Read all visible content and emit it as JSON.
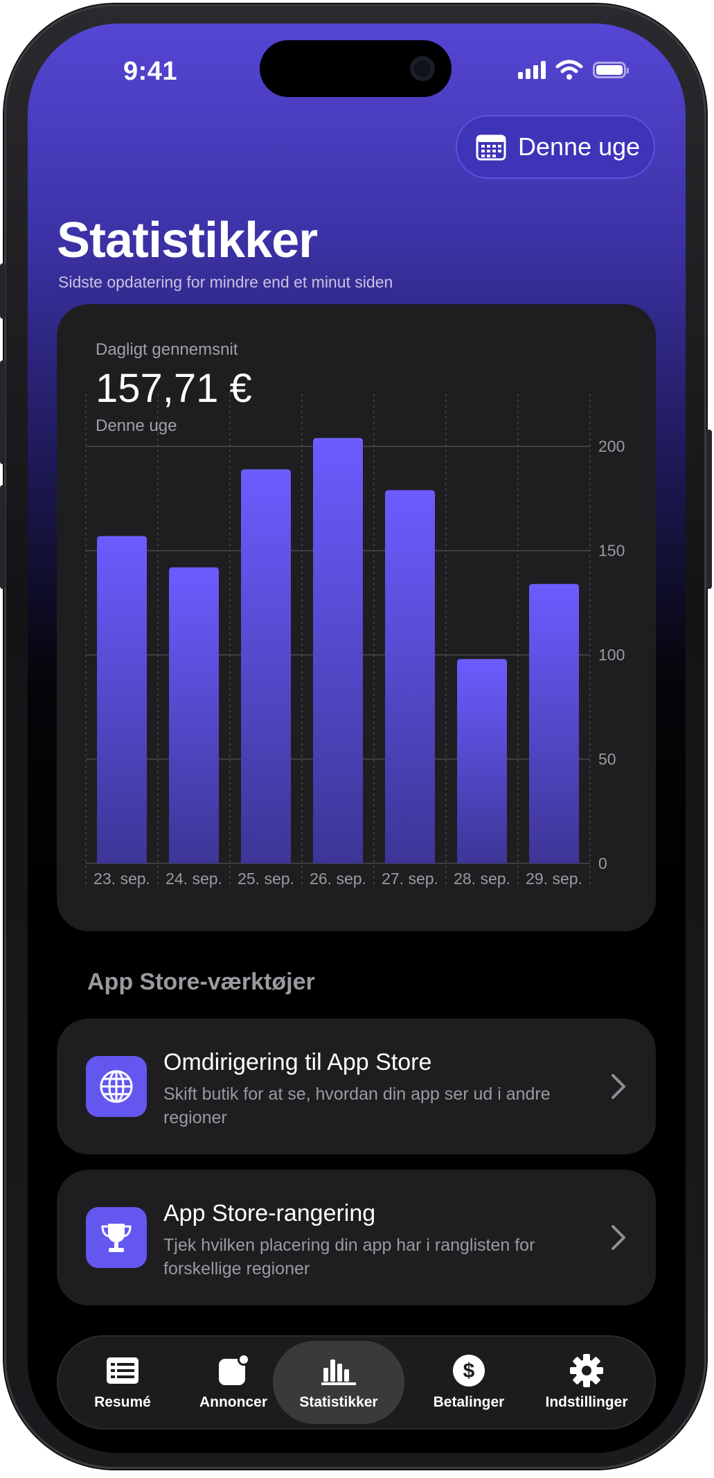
{
  "status_bar": {
    "time": "9:41"
  },
  "header": {
    "period_button": "Denne uge",
    "title": "Statistikker",
    "subtitle": "Sidste opdatering for mindre end et minut siden"
  },
  "summary": {
    "label": "Dagligt gennemsnit",
    "value": "157,71 €",
    "period": "Denne uge"
  },
  "chart_data": {
    "type": "bar",
    "categories": [
      "23. sep.",
      "24. sep.",
      "25. sep.",
      "26. sep.",
      "27. sep.",
      "28. sep.",
      "29. sep."
    ],
    "values": [
      157,
      142,
      189,
      204,
      179,
      98,
      134
    ],
    "ylim": [
      0,
      225
    ],
    "yticks": [
      0,
      50,
      100,
      150,
      200
    ],
    "ytick_labels": [
      "0",
      "50",
      "100",
      "150",
      "200"
    ],
    "y_axis_position": "right",
    "grid": true,
    "colors": {
      "bar_top": "#6c5cff",
      "bar_bottom": "#3d3596"
    }
  },
  "tools": {
    "section_title": "App Store-værktøjer",
    "items": [
      {
        "icon": "globe-icon",
        "title": "Omdirigering til App Store",
        "description": "Skift butik for at se, hvordan din app ser ud i andre regioner"
      },
      {
        "icon": "trophy-icon",
        "title": "App Store-rangering",
        "description": "Tjek hvilken placering din app har i ranglisten for forskellige regioner"
      }
    ]
  },
  "tab_bar": {
    "active": "Statistikker",
    "items": [
      {
        "label": "Resumé",
        "icon": "document-list-icon"
      },
      {
        "label": "Annoncer",
        "icon": "notification-badge-icon"
      },
      {
        "label": "Statistikker",
        "icon": "bar-chart-icon"
      },
      {
        "label": "Betalinger",
        "icon": "dollar-icon"
      },
      {
        "label": "Indstillinger",
        "icon": "gear-icon"
      }
    ]
  },
  "colors": {
    "accent": "#6357f0",
    "card": "#1e1e20",
    "header_gradient_top": "#5546d4"
  }
}
